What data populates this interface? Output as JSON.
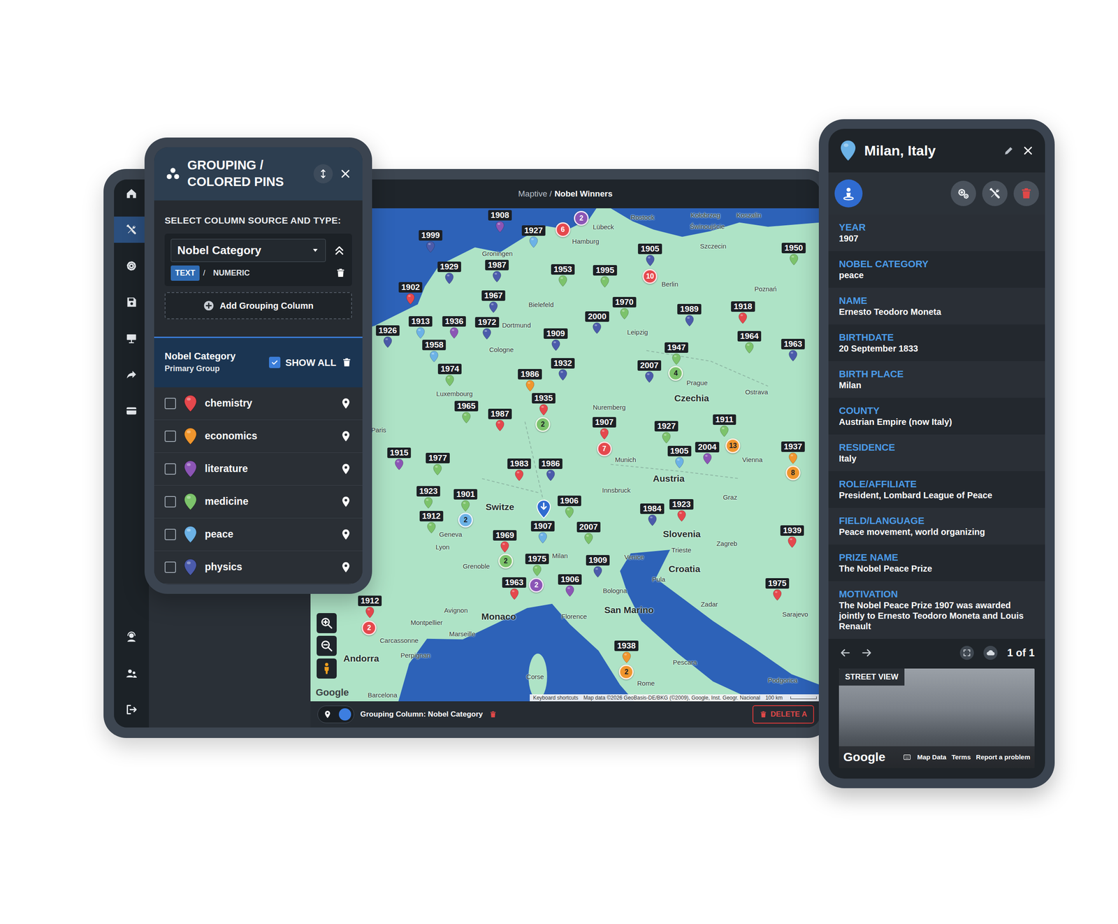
{
  "topbar": {
    "crumb": "Maptive /",
    "title": "Nobel Winners"
  },
  "sidebar": {
    "items": [
      {
        "selected": false
      },
      {
        "selected": true
      },
      {
        "selected": false
      },
      {
        "selected": false
      },
      {
        "selected": false
      },
      {
        "selected": false
      },
      {
        "selected": false
      },
      {
        "selected": false
      },
      {
        "selected": false
      },
      {
        "selected": false
      }
    ]
  },
  "grouping": {
    "title": [
      "GROUPING /",
      "COLORED PINS"
    ],
    "source_label": "SELECT COLUMN SOURCE AND TYPE:",
    "column": "Nobel Category",
    "types": [
      {
        "label": "TEXT",
        "selected": true
      },
      {
        "label": "NUMERIC",
        "selected": false
      }
    ],
    "type_separator": "/",
    "add_button": "Add Grouping Column",
    "group": {
      "name": "Nobel Category",
      "role": "Primary Group",
      "show_all_label": "SHOW ALL",
      "show_all": true
    },
    "categories": [
      {
        "name": "chemistry",
        "checked": false,
        "color": "#e5484d"
      },
      {
        "name": "economics",
        "checked": false,
        "color": "#f0962e"
      },
      {
        "name": "literature",
        "checked": false,
        "color": "#8b55b5"
      },
      {
        "name": "medicine",
        "checked": false,
        "color": "#7cc36b"
      },
      {
        "name": "peace",
        "checked": false,
        "color": "#6cb2e6"
      },
      {
        "name": "physics",
        "checked": false,
        "color": "#4b5bab"
      }
    ]
  },
  "map": {
    "pins": [
      {
        "label": "1908",
        "color": "#8b55b5",
        "pos": [
          265,
          10
        ]
      },
      {
        "label": "1927",
        "color": "#6cb2e6",
        "pos": [
          312,
          31
        ]
      },
      {
        "label": "1999",
        "color": "#4b5bab",
        "pos": [
          168,
          38
        ]
      },
      {
        "label": "1929",
        "color": "#4b5bab",
        "pos": [
          194,
          82
        ]
      },
      {
        "label": "1987",
        "color": "#4b5bab",
        "pos": [
          261,
          80
        ]
      },
      {
        "label": "1953",
        "color": "#7cc36b",
        "pos": [
          353,
          86
        ]
      },
      {
        "label": "1905",
        "color": "#4b5bab",
        "pos": [
          475,
          57
        ]
      },
      {
        "label": "1995",
        "color": "#7cc36b",
        "pos": [
          412,
          87
        ]
      },
      {
        "label": "1950",
        "color": "#7cc36b",
        "pos": [
          676,
          56
        ]
      },
      {
        "label": "1902",
        "color": "#e5484d",
        "pos": [
          140,
          111
        ]
      },
      {
        "label": "1967",
        "color": "#4b5bab",
        "pos": [
          256,
          123
        ]
      },
      {
        "label": "1970",
        "color": "#7cc36b",
        "pos": [
          439,
          132
        ]
      },
      {
        "label": "2000",
        "color": "#4b5bab",
        "pos": [
          401,
          152
        ]
      },
      {
        "label": "1989",
        "color": "#4b5bab",
        "pos": [
          530,
          142
        ]
      },
      {
        "label": "1918",
        "color": "#e5484d",
        "pos": [
          605,
          138
        ]
      },
      {
        "label": "1913",
        "color": "#6cb2e6",
        "pos": [
          154,
          159
        ]
      },
      {
        "label": "1936",
        "color": "#8b55b5",
        "pos": [
          201,
          159
        ]
      },
      {
        "label": "1972",
        "color": "#4b5bab",
        "pos": [
          247,
          160
        ]
      },
      {
        "label": "1909",
        "color": "#4b5bab",
        "pos": [
          343,
          176
        ]
      },
      {
        "label": "1964",
        "color": "#7cc36b",
        "pos": [
          614,
          180
        ]
      },
      {
        "label": "1926",
        "color": "#4b5bab",
        "pos": [
          108,
          172
        ]
      },
      {
        "label": "1958",
        "color": "#6cb2e6",
        "pos": [
          173,
          192
        ]
      },
      {
        "label": "1947",
        "color": "#7cc36b",
        "pos": [
          512,
          196
        ]
      },
      {
        "label": "1963",
        "color": "#4b5bab",
        "pos": [
          675,
          191
        ]
      },
      {
        "label": "1932",
        "color": "#4b5bab",
        "pos": [
          353,
          218
        ]
      },
      {
        "label": "2007",
        "color": "#4b5bab",
        "pos": [
          474,
          221
        ]
      },
      {
        "label": "1974",
        "color": "#7cc36b",
        "pos": [
          195,
          226
        ]
      },
      {
        "label": "1986",
        "color": "#f0962e",
        "pos": [
          307,
          233
        ]
      },
      {
        "label": "1935",
        "color": "#e5484d",
        "pos": [
          326,
          267
        ]
      },
      {
        "label": "1965",
        "color": "#7cc36b",
        "pos": [
          218,
          278
        ]
      },
      {
        "label": "1987",
        "color": "#e5484d",
        "pos": [
          265,
          289
        ]
      },
      {
        "label": "1907",
        "color": "#e5484d",
        "pos": [
          411,
          301
        ]
      },
      {
        "label": "1927",
        "color": "#7cc36b",
        "pos": [
          498,
          306
        ]
      },
      {
        "label": "1911",
        "color": "#7cc36b",
        "pos": [
          579,
          297
        ]
      },
      {
        "label": "1937",
        "color": "#f0962e",
        "pos": [
          675,
          335
        ]
      },
      {
        "label": "1915",
        "color": "#8b55b5",
        "pos": [
          124,
          344
        ]
      },
      {
        "label": "1977",
        "color": "#7cc36b",
        "pos": [
          178,
          351
        ]
      },
      {
        "label": "1983",
        "color": "#e5484d",
        "pos": [
          292,
          359
        ]
      },
      {
        "label": "1986",
        "color": "#4b5bab",
        "pos": [
          336,
          359
        ]
      },
      {
        "label": "1905",
        "color": "#6cb2e6",
        "pos": [
          516,
          341
        ]
      },
      {
        "label": "2004",
        "color": "#8b55b5",
        "pos": [
          555,
          336
        ]
      },
      {
        "label": "1923",
        "color": "#7cc36b",
        "pos": [
          165,
          398
        ]
      },
      {
        "label": "1901",
        "color": "#7cc36b",
        "pos": [
          217,
          402
        ]
      },
      {
        "label": "1906",
        "color": "#7cc36b",
        "pos": [
          362,
          411
        ]
      },
      {
        "label": "1984",
        "color": "#4b5bab",
        "pos": [
          478,
          422
        ]
      },
      {
        "label": "1923",
        "color": "#e5484d",
        "pos": [
          519,
          416
        ]
      },
      {
        "label": "1912",
        "color": "#7cc36b",
        "pos": [
          169,
          433
        ]
      },
      {
        "label": "1969",
        "color": "#e5484d",
        "pos": [
          272,
          460
        ]
      },
      {
        "label": "1907",
        "color": "#6cb2e6",
        "pos": [
          325,
          447
        ]
      },
      {
        "label": "2007",
        "color": "#7cc36b",
        "pos": [
          389,
          448
        ]
      },
      {
        "label": "1939",
        "color": "#e5484d",
        "pos": [
          674,
          453
        ]
      },
      {
        "label": "1975",
        "color": "#7cc36b",
        "pos": [
          317,
          493
        ]
      },
      {
        "label": "1909",
        "color": "#4b5bab",
        "pos": [
          402,
          495
        ]
      },
      {
        "label": "1963",
        "color": "#e5484d",
        "pos": [
          285,
          526
        ]
      },
      {
        "label": "1906",
        "color": "#8b55b5",
        "pos": [
          363,
          522
        ]
      },
      {
        "label": "1975",
        "color": "#e5484d",
        "pos": [
          653,
          527
        ]
      },
      {
        "label": "1912",
        "color": "#e5484d",
        "pos": [
          83,
          552
        ]
      },
      {
        "label": "1938",
        "color": "#f0962e",
        "pos": [
          442,
          615
        ]
      }
    ],
    "clusters": [
      {
        "count": "2",
        "color": "#8b55b5",
        "pos": [
          379,
          14
        ]
      },
      {
        "count": "6",
        "color": "#e5484d",
        "pos": [
          353,
          30
        ]
      },
      {
        "count": "10",
        "color": "#e5484d",
        "pos": [
          475,
          96
        ]
      },
      {
        "count": "4",
        "color": "#7cc36b",
        "pos": [
          511,
          232
        ]
      },
      {
        "count": "2",
        "color": "#7cc36b",
        "pos": [
          325,
          304
        ]
      },
      {
        "count": "7",
        "color": "#e5484d",
        "pos": [
          411,
          338
        ]
      },
      {
        "count": "13",
        "color": "#f0962e",
        "pos": [
          591,
          334
        ]
      },
      {
        "count": "8",
        "color": "#f0962e",
        "pos": [
          675,
          372
        ]
      },
      {
        "count": "2",
        "color": "#6cb2e6",
        "pos": [
          217,
          438
        ]
      },
      {
        "count": "2",
        "color": "#7cc36b",
        "pos": [
          273,
          496
        ]
      },
      {
        "count": "2",
        "color": "#8b55b5",
        "pos": [
          316,
          530
        ]
      },
      {
        "count": "2",
        "color": "#e5484d",
        "pos": [
          82,
          590
        ]
      },
      {
        "count": "2",
        "color": "#f0962e",
        "pos": [
          442,
          652
        ]
      }
    ],
    "places": [
      {
        "text": "Rostock",
        "kind": "city",
        "pos": [
          448,
          12
        ]
      },
      {
        "text": "Kołobrzeg",
        "kind": "city",
        "pos": [
          532,
          9
        ]
      },
      {
        "text": "Koszalin",
        "kind": "city",
        "pos": [
          596,
          9
        ]
      },
      {
        "text": "Świnoujście",
        "kind": "city",
        "pos": [
          531,
          25
        ]
      },
      {
        "text": "Szczecin",
        "kind": "city",
        "pos": [
          545,
          53
        ]
      },
      {
        "text": "Lübeck",
        "kind": "city",
        "pos": [
          395,
          26
        ]
      },
      {
        "text": "Hamburg",
        "kind": "city",
        "pos": [
          366,
          46
        ]
      },
      {
        "text": "Groningen",
        "kind": "city",
        "pos": [
          240,
          63
        ]
      },
      {
        "text": "Berlin",
        "kind": "city",
        "pos": [
          491,
          106
        ]
      },
      {
        "text": "Poznań",
        "kind": "city",
        "pos": [
          621,
          113
        ]
      },
      {
        "text": "Bielefeld",
        "kind": "city",
        "pos": [
          305,
          135
        ]
      },
      {
        "text": "Dortmund",
        "kind": "city",
        "pos": [
          268,
          164
        ]
      },
      {
        "text": "Leipzig",
        "kind": "city",
        "pos": [
          443,
          174
        ]
      },
      {
        "text": "Cologne",
        "kind": "city",
        "pos": [
          250,
          198
        ]
      },
      {
        "text": "Luxembourg",
        "kind": "city",
        "pos": [
          176,
          260
        ]
      },
      {
        "text": "Nuremberg",
        "kind": "city",
        "pos": [
          395,
          279
        ]
      },
      {
        "text": "Munich",
        "kind": "city",
        "pos": [
          426,
          353
        ]
      },
      {
        "text": "Prague",
        "kind": "city",
        "pos": [
          526,
          245
        ]
      },
      {
        "text": "Czechia",
        "kind": "country",
        "pos": [
          509,
          267
        ]
      },
      {
        "text": "Ostrava",
        "kind": "city",
        "pos": [
          608,
          258
        ]
      },
      {
        "text": "Vienna",
        "kind": "city",
        "pos": [
          604,
          353
        ]
      },
      {
        "text": "Austria",
        "kind": "country",
        "pos": [
          479,
          380
        ]
      },
      {
        "text": "Innsbruck",
        "kind": "city",
        "pos": [
          408,
          396
        ]
      },
      {
        "text": "Graz",
        "kind": "city",
        "pos": [
          577,
          406
        ]
      },
      {
        "text": "Paris",
        "kind": "city",
        "pos": [
          85,
          311
        ]
      },
      {
        "text": "Switze",
        "kind": "country",
        "pos": [
          245,
          420
        ]
      },
      {
        "text": "Geneva",
        "kind": "city",
        "pos": [
          180,
          458
        ]
      },
      {
        "text": "Lyon",
        "kind": "city",
        "pos": [
          175,
          476
        ]
      },
      {
        "text": "Grenoble",
        "kind": "city",
        "pos": [
          213,
          503
        ]
      },
      {
        "text": "Milan",
        "kind": "city",
        "pos": [
          338,
          488
        ]
      },
      {
        "text": "Monaco",
        "kind": "country",
        "pos": [
          239,
          574
        ]
      },
      {
        "text": "Florence",
        "kind": "city",
        "pos": [
          351,
          573
        ]
      },
      {
        "text": "Bologna",
        "kind": "city",
        "pos": [
          409,
          537
        ]
      },
      {
        "text": "San Marino",
        "kind": "country",
        "pos": [
          411,
          565
        ]
      },
      {
        "text": "Venice",
        "kind": "city",
        "pos": [
          439,
          490
        ]
      },
      {
        "text": "Slovenia",
        "kind": "country",
        "pos": [
          493,
          458
        ]
      },
      {
        "text": "Trieste",
        "kind": "city",
        "pos": [
          505,
          480
        ]
      },
      {
        "text": "Zagreb",
        "kind": "city",
        "pos": [
          568,
          471
        ]
      },
      {
        "text": "Croatia",
        "kind": "country",
        "pos": [
          501,
          507
        ]
      },
      {
        "text": "Pula",
        "kind": "city",
        "pos": [
          478,
          521
        ]
      },
      {
        "text": "Zadar",
        "kind": "city",
        "pos": [
          546,
          556
        ]
      },
      {
        "text": "Sarajevo",
        "kind": "city",
        "pos": [
          660,
          570
        ]
      },
      {
        "text": "Podgorica",
        "kind": "city",
        "pos": [
          640,
          663
        ]
      },
      {
        "text": "Rome",
        "kind": "city",
        "pos": [
          457,
          667
        ]
      },
      {
        "text": "Pescara",
        "kind": "city",
        "pos": [
          507,
          638
        ]
      },
      {
        "text": "Corse",
        "kind": "city",
        "pos": [
          302,
          658
        ]
      },
      {
        "text": "Marseille",
        "kind": "city",
        "pos": [
          194,
          598
        ]
      },
      {
        "text": "Avignon",
        "kind": "city",
        "pos": [
          187,
          565
        ]
      },
      {
        "text": "Montpellier",
        "kind": "city",
        "pos": [
          140,
          582
        ]
      },
      {
        "text": "Carcassonne",
        "kind": "city",
        "pos": [
          97,
          607
        ]
      },
      {
        "text": "Perpignan",
        "kind": "city",
        "pos": [
          126,
          628
        ]
      },
      {
        "text": "Andorra",
        "kind": "country",
        "pos": [
          46,
          633
        ]
      },
      {
        "text": "Barcelona",
        "kind": "city",
        "pos": [
          80,
          684
        ]
      }
    ],
    "selected_pin": {
      "color": "#2f6bd0",
      "pos": [
        326,
        423
      ]
    },
    "logo": "Google",
    "attribution": [
      "Keyboard shortcuts",
      "Map data ©2026 GeoBasis-DE/BKG (©2009), Google, Inst. Geogr. Nacional",
      "100 km"
    ]
  },
  "bottom_bar": {
    "toggle_on": true,
    "label": "Grouping Column: Nobel Category",
    "delete_label": "DELETE A"
  },
  "detail": {
    "title": "Milan, Italy",
    "fields": [
      {
        "label": "YEAR",
        "value": "1907"
      },
      {
        "label": "NOBEL CATEGORY",
        "value": "peace"
      },
      {
        "label": "NAME",
        "value": "Ernesto Teodoro Moneta"
      },
      {
        "label": "BIRTHDATE",
        "value": "20 September 1833"
      },
      {
        "label": "BIRTH PLACE",
        "value": "Milan"
      },
      {
        "label": "COUNTY",
        "value": "Austrian Empire (now Italy)"
      },
      {
        "label": "RESIDENCE",
        "value": "Italy"
      },
      {
        "label": "ROLE/AFFILIATE",
        "value": "President, Lombard League of Peace"
      },
      {
        "label": "FIELD/LANGUAGE",
        "value": "Peace movement, world organizing"
      },
      {
        "label": "PRIZE NAME",
        "value": "The Nobel Peace Prize"
      },
      {
        "label": "MOTIVATION",
        "value": "The Nobel Peace Prize 1907 was awarded jointly to Ernesto Teodoro Moneta and Louis Renault"
      }
    ],
    "pager": "1 of 1",
    "street_view": {
      "label": "STREET VIEW",
      "logo": "Google",
      "links": [
        "Map Data",
        "Terms",
        "Report a problem"
      ]
    }
  }
}
